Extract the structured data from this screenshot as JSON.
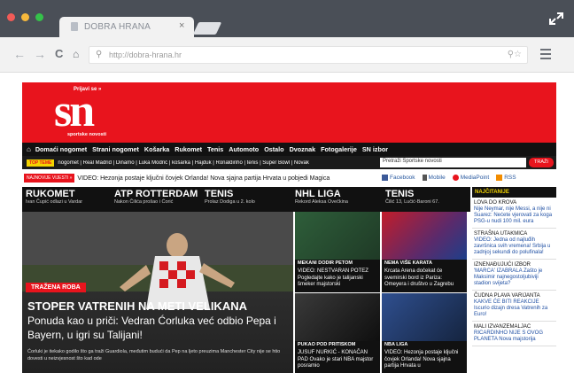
{
  "browser": {
    "tab_title": "DOBRA HRANA",
    "tab_close": "×",
    "address": "http://dobra-hrana.hr"
  },
  "site": {
    "login": "Prijavi se »",
    "logo": "sn",
    "logo_sub": "sportske novosti"
  },
  "mainnav": [
    "Domaći nogomet",
    "Strani nogomet",
    "Košarka",
    "Rukomet",
    "Tenis",
    "Automoto",
    "Ostalo",
    "Dvoznak",
    "Fotogalerije",
    "SN izbor"
  ],
  "subnav": {
    "badge": "TOP TEME",
    "links": "nogomet | Real Madrid | Dinamo | Luka Modrić | košarka | Hajduk | Ronaldinho | tenis | Super Bowl | Novak",
    "search_placeholder": "Pretraži Sportske novosti",
    "search_button": "TRAŽI"
  },
  "breaking": {
    "label": "NAJNOVIJE VIJESTI »",
    "text": "VIDEO: Hezonja postaje ključni čovjek Orlanda! Nova sjajna partija Hrvata u pobjedi Magica"
  },
  "social": [
    "Facebook",
    "Mobile",
    "MediaPoint",
    "RSS"
  ],
  "categories": [
    {
      "title": "RUKOMET",
      "sub": "Ivan Čupić odlazi u Vardar"
    },
    {
      "title": "ATP ROTTERDAM",
      "sub": "Nakon Čilića prošao i Ćorić"
    },
    {
      "title": "TENIS",
      "sub": "Prolaz Dodiga u 2. kolo"
    },
    {
      "title": "NHL LIGA",
      "sub": "Rekord Aleksa Ovečkina"
    },
    {
      "title": "TENIS",
      "sub": "Čilić 13, Lučić-Baroni 67."
    }
  ],
  "hero": {
    "tag": "TRAŽENA ROBA",
    "headline": "STOPER VATRENIH NA METI VELIKANA",
    "subhead": "Ponuda kao u priči: Vedran Ćorluka već odbio Pepa i Bayern, u igri su Talijani!",
    "lede": "Ćorluki je itekako godilo što ga traži Guardiola, međutim budući da Pep na ljeto preuzima Manchester City nije se htio dovesti u neizvjesnost što kad ode"
  },
  "tiles": [
    {
      "label": "MEKANI DODIR PETOM",
      "text": "VIDEO: NESTVARAN POTEZ Pogledajte kako je talijanski šmeker majstorski"
    },
    {
      "label": "NEMA VIŠE KARATA",
      "text": "Krcata Arena dočekat će svemirski bord iz Pariza: Omeyera i društvo u Zagrebu"
    },
    {
      "label": "PUKAO POD PRITISKOM",
      "text": "JUSUF NURKIĆ - KONAČAN PAD Ovako je stari NBA majstor posramio"
    },
    {
      "label": "NBA LIGA",
      "text": "VIDEO: Hezonja postaje ključni čovjek Orlanda! Nova sjajna partija Hrvata u"
    }
  ],
  "sidebar": {
    "title": "NAJČITANIJE",
    "items": [
      {
        "title": "LOVA DO KROVA",
        "desc": "Nije Neymar, nije Messi, a nije ni Suarez: Nećete vjerovati za koga PSG-u nudi 100 mil. eura"
      },
      {
        "title": "STRAŠNA UTAKMICA",
        "desc": "VIDEO: Jedna od najluđih završnica svih vremena! Srbija u zadnjoj sekundi do polufinala!"
      },
      {
        "title": "IZNENAĐUJUĆI IZBOR",
        "desc": "'MARCA' IZABRALA Zašto je Maksimir najnegostoljubiviji stadion svijeta?"
      },
      {
        "title": "ČUDNA PLAVA VARIJANTA",
        "desc": "KAKVE ĆE BITI REAKCIJE Iscurio dizajn dresa Vatrenih za Euro!"
      },
      {
        "title": "MALI IZVANZEMALJAC",
        "desc": "RICARDINHO NIJE S OVOG PLANETA Nova majstorija"
      }
    ]
  }
}
